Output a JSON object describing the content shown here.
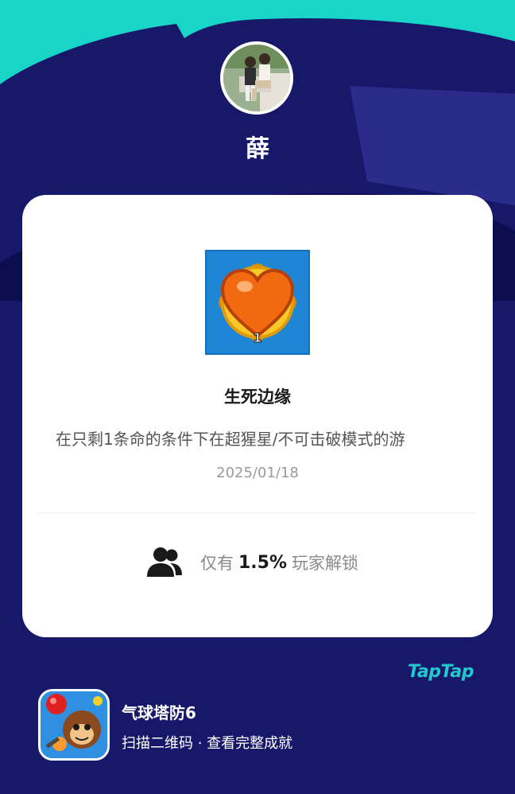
{
  "theme": {
    "background": "#17186a",
    "accent": "#22c8cc",
    "card": "#ffffff"
  },
  "profile": {
    "username": "薛",
    "avatar_icon": "user-photo"
  },
  "achievement": {
    "icon": "heart-medal-icon",
    "badge_number": "1",
    "title": "生死边缘",
    "description": "在只剩1条命的条件下在超猩星/不可击破模式的游",
    "date": "2025/01/18"
  },
  "stats": {
    "icon": "users-icon",
    "prefix": "仅有",
    "rate": "1.5%",
    "suffix": "玩家解锁"
  },
  "brand": {
    "logo_text": "TapTap"
  },
  "game": {
    "icon": "monkey-game-icon",
    "name": "气球塔防6",
    "hint": "扫描二维码 · 查看完整成就"
  }
}
